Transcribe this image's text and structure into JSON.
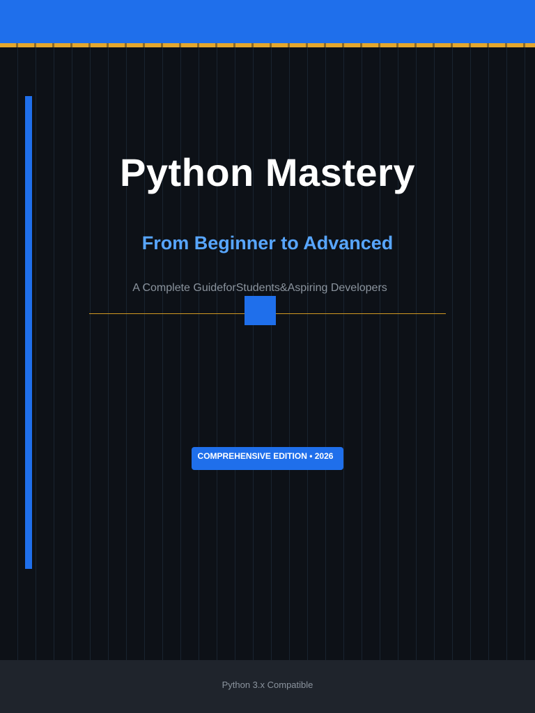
{
  "cover": {
    "title": "Python Mastery",
    "subtitle": "From Beginner to Advanced",
    "tagline": "A Complete GuideforStudents&Aspiring Developers",
    "edition": "COMPREHENSIVE EDITION • 2026",
    "footer": "Python 3.x Compatible"
  },
  "colors": {
    "background": "#0d1117",
    "accent_blue": "#1f6feb",
    "subtitle_blue": "#58a6ff",
    "gold": "#d29922",
    "muted_text": "#8b949e",
    "footer_bg": "#1f242c"
  }
}
